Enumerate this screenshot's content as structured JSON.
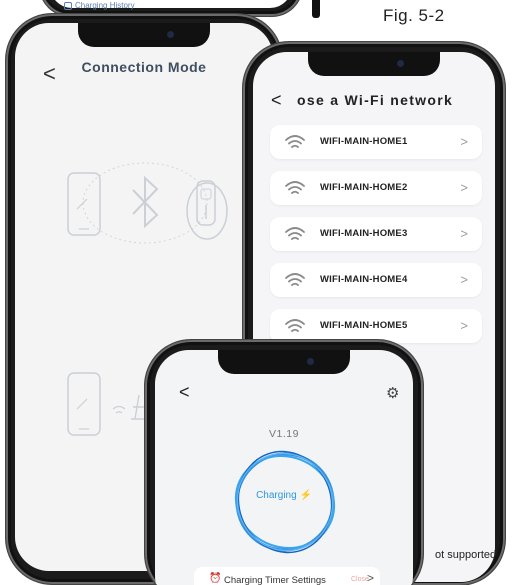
{
  "figure_label": "Fig. 5-2",
  "top_phone": {
    "history_label": "Charging History"
  },
  "connection_mode": {
    "back": "<",
    "title": "Connection Mode"
  },
  "wifi_list": {
    "back": "<",
    "title": "ose a Wi-Fi network",
    "networks": [
      "WIFI-MAIN-HOME1",
      "WIFI-MAIN-HOME2",
      "WIFI-MAIN-HOME3",
      "WIFI-MAIN-HOME4",
      "WIFI-MAIN-HOME5"
    ],
    "footer_text": "ot supported",
    "chevron": ">"
  },
  "charging": {
    "back": "<",
    "version": "V1.19",
    "status": "Charging",
    "timer_label": "Charging Timer Settings",
    "timer_close": "Close",
    "timer_chevron": ">"
  },
  "colors": {
    "accent_blue": "#2f97e0",
    "title_slate": "#3f4f61",
    "wifi_icon": "#8a8a8a",
    "close_pink": "#e9a6a6"
  },
  "icons": {
    "bluetooth": "bluetooth-icon",
    "wifi": "wifi-icon",
    "phone": "phone-icon",
    "charger": "charger-icon",
    "settings": "gear-icon",
    "alarm": "alarm-clock-icon",
    "lightning": "lightning-icon"
  }
}
